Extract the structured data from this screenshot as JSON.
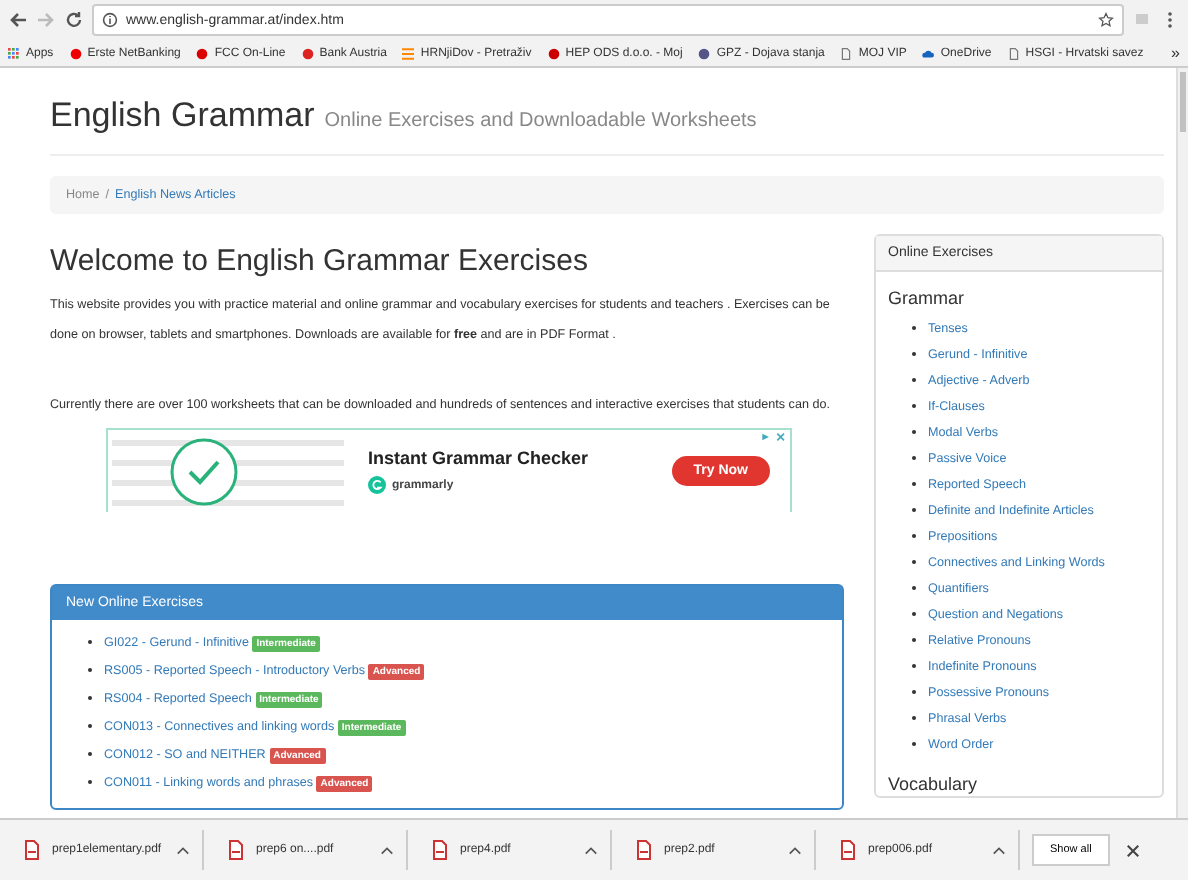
{
  "browser": {
    "url": "www.english-grammar.at/index.htm",
    "bookmarks": [
      {
        "label": "Apps",
        "kind": "apps"
      },
      {
        "label": "Erste NetBanking",
        "kind": "bank"
      },
      {
        "label": "FCC On-Line",
        "kind": "bag"
      },
      {
        "label": "Bank Austria",
        "kind": "ball"
      },
      {
        "label": "HRNjiDov - Pretraživ",
        "kind": "bars"
      },
      {
        "label": "HEP ODS d.o.o. - Moj",
        "kind": "flag"
      },
      {
        "label": "GPZ - Dojava stanja",
        "kind": "crest"
      },
      {
        "label": "MOJ VIP",
        "kind": "page"
      },
      {
        "label": "OneDrive",
        "kind": "cloud"
      },
      {
        "label": "HSGI - Hrvatski savez",
        "kind": "page"
      }
    ],
    "more": "»"
  },
  "header": {
    "title": "English Grammar",
    "subtitle": "Online Exercises and Downloadable Worksheets"
  },
  "breadcrumb": {
    "separator": "/",
    "items": [
      "Home",
      "English News Articles"
    ]
  },
  "main": {
    "heading": "Welcome to English Grammar Exercises",
    "intro": "This website provides you with practice material and online grammar and vocabulary exercises for students and teachers . Exercises can be done on browser, tablets and smartphones. Downloads are available for **free** and are in PDF Format .",
    "currently": "Currently there are over 100 worksheets that can be downloaded and hundreds of sentences and interactive exercises that students can do."
  },
  "ad": {
    "title": "Instant Grammar Checker",
    "brand": "grammarly",
    "button": "Try Now"
  },
  "new_exercises": {
    "title": "New Online Exercises",
    "items": [
      {
        "code": "GI022 - Gerund - Infinitive",
        "level": "Intermediate",
        "kind": "intermediate"
      },
      {
        "code": "RS005 - Reported Speech - Introductory Verbs",
        "level": "Advanced",
        "kind": "advanced"
      },
      {
        "code": "RS004 - Reported Speech",
        "level": "Intermediate",
        "kind": "intermediate"
      },
      {
        "code": "CON013 - Connectives and linking words",
        "level": "Intermediate",
        "kind": "intermediate"
      },
      {
        "code": "CON012 - SO and NEITHER",
        "level": "Advanced",
        "kind": "advanced"
      },
      {
        "code": "CON011 - Linking words and phrases",
        "level": "Advanced",
        "kind": "advanced"
      }
    ]
  },
  "sidebar": {
    "title": "Online Exercises",
    "section": "Grammar",
    "items": [
      "Tenses",
      "Gerund - Infinitive",
      "Adjective - Adverb",
      "If-Clauses",
      "Modal Verbs",
      "Passive Voice",
      "Reported Speech",
      "Definite and Indefinite Articles",
      "Prepositions",
      "Connectives and Linking Words",
      "Quantifiers",
      "Question and Negations",
      "Relative Pronouns",
      "Indefinite Pronouns",
      "Possessive Pronouns",
      "Phrasal Verbs",
      "Word Order"
    ],
    "next_section": "Vocabulary"
  },
  "downloads": {
    "files": [
      "prep1elementary.pdf",
      "prep6 on....pdf",
      "prep4.pdf",
      "prep2.pdf",
      "prep006.pdf"
    ],
    "show_all": "Show all"
  }
}
